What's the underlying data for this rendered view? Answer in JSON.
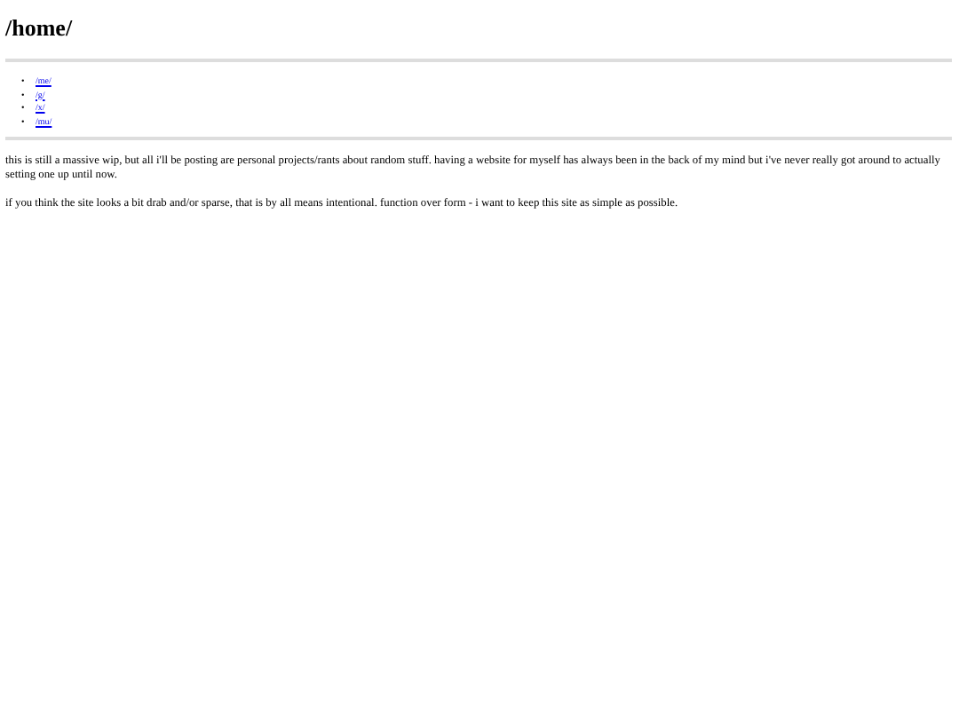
{
  "heading": "/home/",
  "nav_links": [
    {
      "marker": "•",
      "label": "/me/"
    },
    {
      "marker": "•",
      "label": "/g/"
    },
    {
      "marker": "•",
      "label": "/x/"
    },
    {
      "marker": "•",
      "label": "/mu/"
    }
  ],
  "paragraphs": [
    "this is still a massive wip, but all i'll be posting are personal projects/rants about random stuff. having a website for myself has always been in the back of my mind but i've never really got around to actually setting one up until now.",
    "if you think the site looks a bit drab and/or sparse, that is by all means intentional. function over form - i want to keep this site as simple as possible."
  ]
}
